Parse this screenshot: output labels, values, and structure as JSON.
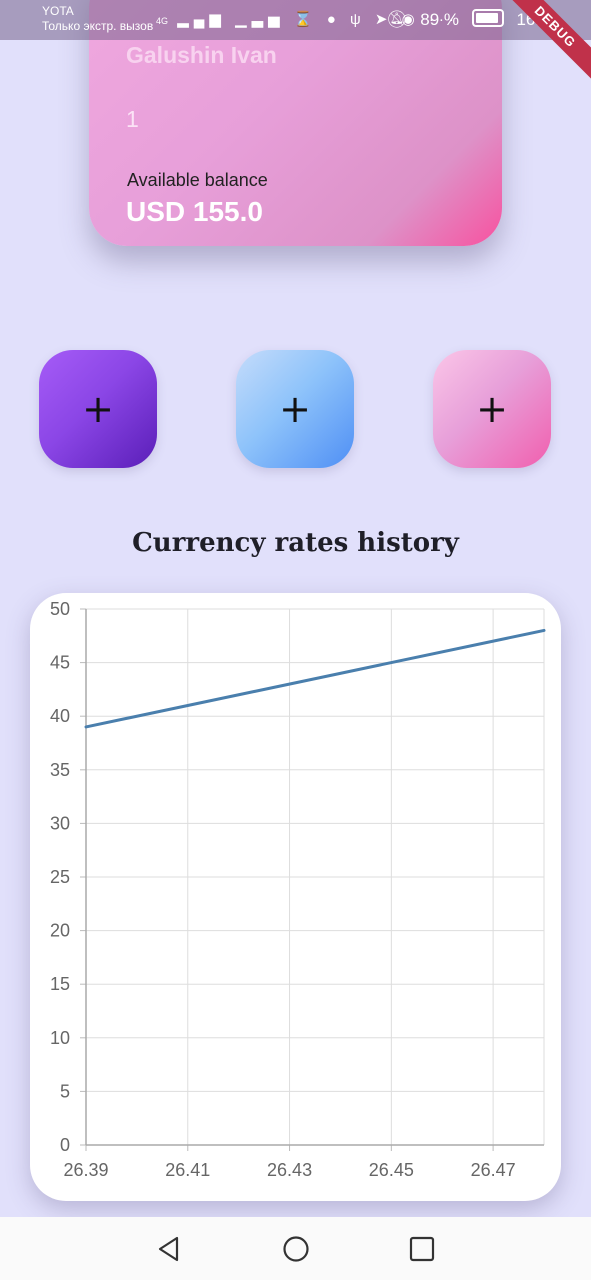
{
  "status_bar": {
    "carrier": "YOTA",
    "carrier_sub": "Только экстр. вызов",
    "network": "4G",
    "icons": [
      "signal-icon",
      "no-signal-icon",
      "hourglass-icon",
      "color-app-icon",
      "usb-icon",
      "telegram-icon",
      "assistant-icon",
      "more-icon"
    ],
    "battery_percent": "89 %",
    "time": "16:26",
    "debug_label": "DEBUG"
  },
  "card": {
    "holder_name": "Galushin Ivan",
    "number": "1",
    "balance_label": "Available balance",
    "balance_value": "USD 155.0"
  },
  "actions": [
    {
      "label": "+",
      "icon": "plus-icon",
      "color": "#8b46e6"
    },
    {
      "label": "+",
      "icon": "plus-icon",
      "color": "#8ec3fa"
    },
    {
      "label": "+",
      "icon": "plus-icon",
      "color": "#e79fd9"
    }
  ],
  "section": {
    "title": "Currency rates history"
  },
  "chart_data": {
    "type": "line",
    "title": "",
    "xlabel": "",
    "ylabel": "",
    "x_ticks": [
      "26.39",
      "26.41",
      "26.43",
      "26.45",
      "26.47"
    ],
    "y_ticks": [
      "0",
      "5",
      "10",
      "15",
      "20",
      "25",
      "30",
      "35",
      "40",
      "45",
      "50"
    ],
    "xlim": [
      26.39,
      26.48
    ],
    "ylim": [
      0,
      50
    ],
    "grid": true,
    "series": [
      {
        "color": "#4a7fad",
        "x": [
          26.39,
          26.48
        ],
        "y": [
          39,
          48
        ]
      }
    ]
  },
  "nav_bar": {
    "items": [
      "back-icon",
      "home-icon",
      "recents-icon"
    ]
  }
}
